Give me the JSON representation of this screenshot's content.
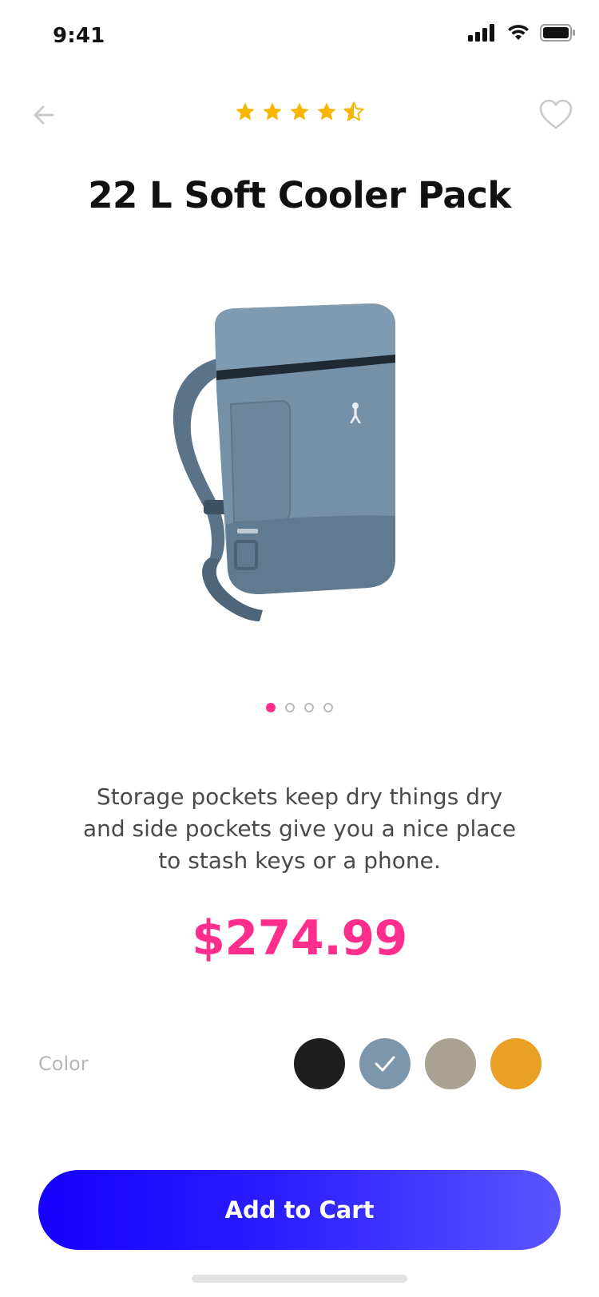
{
  "status_bar": {
    "time": "9:41",
    "icons": [
      "signal-icon",
      "wifi-icon",
      "battery-icon"
    ]
  },
  "header": {
    "back_icon": "arrow-left-icon",
    "favorite_icon": "heart-outline-icon",
    "rating": 4.5,
    "rating_max": 5,
    "star_color": "#F7B500"
  },
  "product": {
    "title": "22 L Soft Cooler Pack",
    "description": "Storage pockets keep dry things dry and side pockets give you a nice place to stash keys or a phone.",
    "price": "$274.99",
    "image_icon": "backpack-cooler-image",
    "image_page_count": 4,
    "image_page_active": 1
  },
  "colors": {
    "label": "Color",
    "options": [
      {
        "name": "black",
        "hex": "#1E1E1E"
      },
      {
        "name": "blue-gray",
        "hex": "#7C97AC",
        "selected": true
      },
      {
        "name": "taupe",
        "hex": "#A9A192"
      },
      {
        "name": "amber",
        "hex": "#E8A124"
      }
    ]
  },
  "cta": {
    "label": "Add to Cart"
  },
  "accent_colors": {
    "pink": "#FF2D8C",
    "blue": "#1600FF"
  }
}
